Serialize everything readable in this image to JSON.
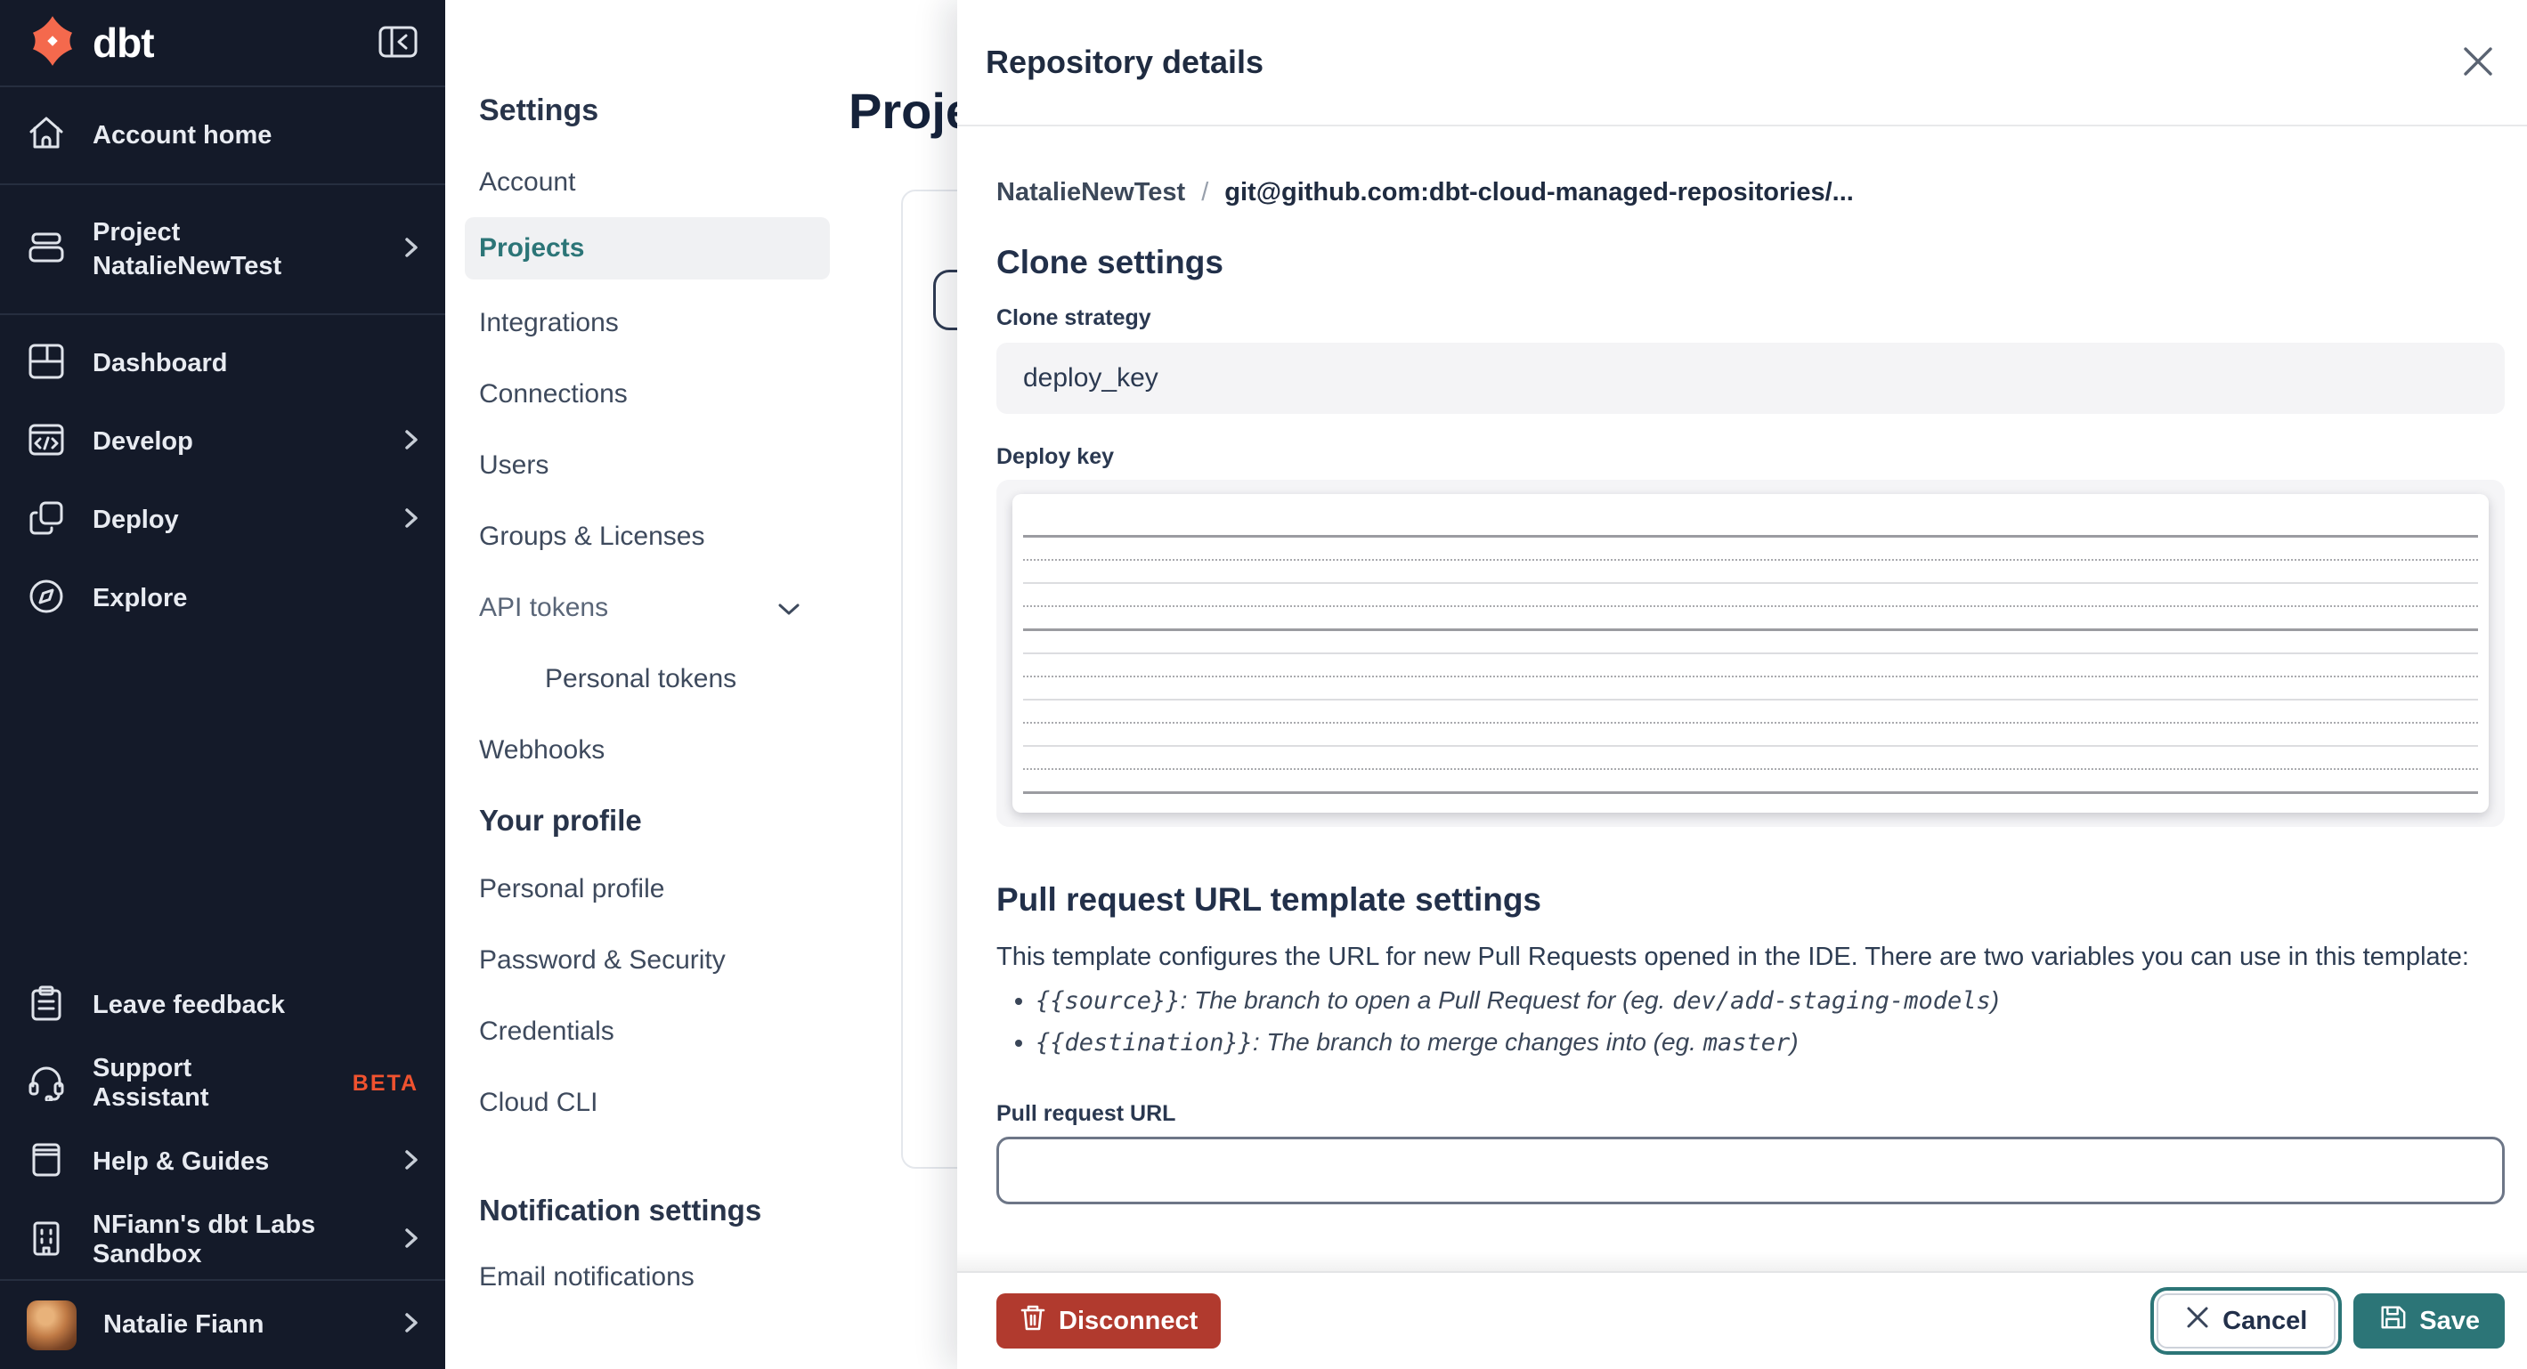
{
  "colors": {
    "accent_teal": "#2c7577",
    "danger_red": "#b13a2e",
    "brand_orange": "#f4694d",
    "beta_orange": "#f0522f",
    "sidebar_bg": "#141a29"
  },
  "sidebar": {
    "brand": "dbt",
    "account_home": "Account home",
    "project": {
      "label": "Project",
      "name": "NatalieNewTest"
    },
    "menu": [
      {
        "label": "Dashboard"
      },
      {
        "label": "Develop"
      },
      {
        "label": "Deploy"
      },
      {
        "label": "Explore"
      }
    ],
    "bottom": [
      {
        "label": "Leave feedback"
      },
      {
        "label": "Support Assistant",
        "badge": "BETA"
      },
      {
        "label": "Help & Guides"
      },
      {
        "label": "NFiann's dbt Labs Sandbox"
      }
    ],
    "user": {
      "name": "Natalie Fiann"
    }
  },
  "settings_nav": {
    "heading": "Settings",
    "items": {
      "account": "Account",
      "projects": "Projects",
      "integrations": "Integrations",
      "connections": "Connections",
      "users": "Users",
      "groups": "Groups & Licenses",
      "api_tokens": "API tokens",
      "personal_tokens": "Personal tokens",
      "webhooks": "Webhooks"
    },
    "profile_heading": "Your profile",
    "profile_items": {
      "personal_profile": "Personal profile",
      "password_security": "Password & Security",
      "credentials": "Credentials",
      "cloud_cli": "Cloud CLI"
    },
    "notifications_heading": "Notification settings",
    "notification_items": {
      "email": "Email notifications"
    }
  },
  "background_page": {
    "title": "Projects"
  },
  "drawer": {
    "title": "Repository details",
    "breadcrumb": {
      "project": "NatalieNewTest",
      "separator": "/",
      "repository": "git@github.com:dbt-cloud-managed-repositories/..."
    },
    "clone": {
      "heading": "Clone settings",
      "strategy_label": "Clone strategy",
      "strategy_value": "deploy_key",
      "key_label": "Deploy key"
    },
    "pr": {
      "heading": "Pull request URL template settings",
      "intro": "This template configures the URL for new Pull Requests opened in the IDE. There are two variables you can use in this template:",
      "bullets": [
        {
          "var": "{{source}}",
          "sep": ": ",
          "desc": "The branch to open a Pull Request for (eg. ",
          "example": "dev/add-staging-models",
          "close": ")"
        },
        {
          "var": "{{destination}}",
          "sep": ": ",
          "desc": "The branch to merge changes into (eg. ",
          "example": "master",
          "close": ")"
        }
      ],
      "url_label": "Pull request URL",
      "url_value": ""
    },
    "actions": {
      "disconnect": "Disconnect",
      "cancel": "Cancel",
      "save": "Save"
    }
  }
}
